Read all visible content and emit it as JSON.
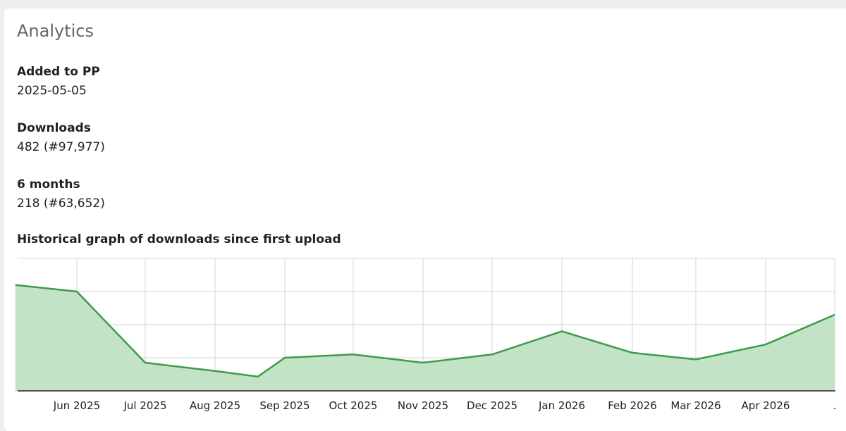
{
  "card": {
    "title": "Analytics",
    "fields": [
      {
        "label": "Added to PP",
        "value": "2025-05-05"
      },
      {
        "label": "Downloads",
        "value": "482 (#97,977)"
      },
      {
        "label": "6 months",
        "value": "218 (#63,652)"
      }
    ],
    "graph_heading": "Historical graph of downloads since first upload"
  },
  "chart_data": {
    "type": "area",
    "grid": true,
    "colors": {
      "line": "#3f9a4a",
      "fill": "#c3e3c7",
      "grid": "#d6d6d6",
      "axis": "#222222"
    },
    "x_tick_labels": [
      "Jun 2025",
      "Jul 2025",
      "Aug 2025",
      "Sep 2025",
      "Oct 2025",
      "Nov 2025",
      "Dec 2025",
      "Jan 2026",
      "Feb 2026",
      "Mar 2026",
      "Apr 2026",
      "."
    ],
    "series": [
      {
        "x": [
          "2025-05-05",
          "2025-06-01",
          "2025-07-01",
          "2025-08-01",
          "2025-08-20",
          "2025-09-01",
          "2025-10-01",
          "2025-11-01",
          "2025-12-01",
          "2026-01-01",
          "2026-02-01",
          "2026-03-01",
          "2026-04-01",
          "2026-05-01"
        ],
        "values": [
          32,
          30,
          8.5,
          6,
          4.3,
          10,
          11,
          8.5,
          11,
          18,
          11.5,
          9.5,
          14,
          23
        ]
      }
    ],
    "ylim": [
      0,
      40
    ]
  }
}
